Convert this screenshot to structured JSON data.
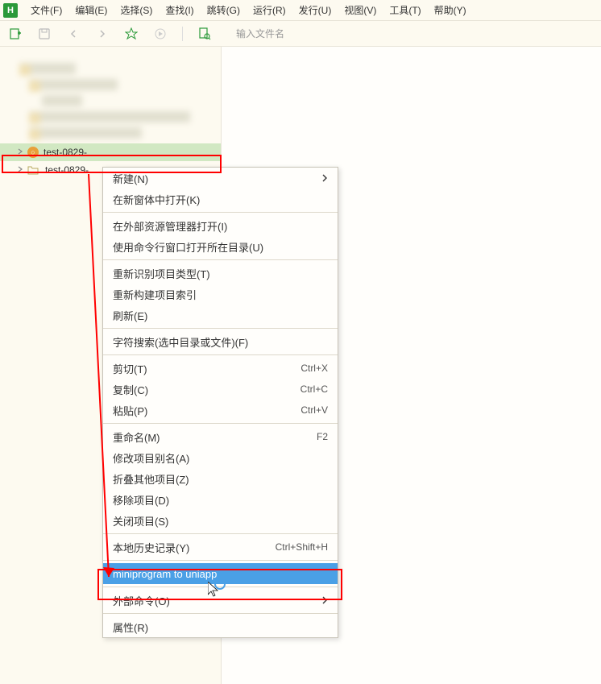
{
  "menubar": {
    "logo": "H",
    "items": [
      "文件(F)",
      "编辑(E)",
      "选择(S)",
      "查找(I)",
      "跳转(G)",
      "运行(R)",
      "发行(U)",
      "视图(V)",
      "工具(T)",
      "帮助(Y)"
    ]
  },
  "toolbar": {
    "search_placeholder": "输入文件名"
  },
  "sidebar": {
    "items": [
      {
        "label": "test-0829-",
        "selected": true
      },
      {
        "label": "test-0829-",
        "selected": false
      }
    ]
  },
  "context_menu": {
    "groups": [
      [
        {
          "label": "新建(N)",
          "submenu": true
        },
        {
          "label": "在新窗体中打开(K)"
        }
      ],
      [
        {
          "label": "在外部资源管理器打开(I)"
        },
        {
          "label": "使用命令行窗口打开所在目录(U)"
        }
      ],
      [
        {
          "label": "重新识别项目类型(T)"
        },
        {
          "label": "重新构建项目索引"
        },
        {
          "label": "刷新(E)"
        }
      ],
      [
        {
          "label": "字符搜索(选中目录或文件)(F)"
        }
      ],
      [
        {
          "label": "剪切(T)",
          "shortcut": "Ctrl+X"
        },
        {
          "label": "复制(C)",
          "shortcut": "Ctrl+C"
        },
        {
          "label": "粘贴(P)",
          "shortcut": "Ctrl+V"
        }
      ],
      [
        {
          "label": "重命名(M)",
          "shortcut": "F2"
        },
        {
          "label": "修改项目别名(A)"
        },
        {
          "label": "折叠其他项目(Z)"
        },
        {
          "label": "移除项目(D)"
        },
        {
          "label": "关闭项目(S)"
        }
      ],
      [
        {
          "label": "本地历史记录(Y)",
          "shortcut": "Ctrl+Shift+H"
        }
      ],
      [
        {
          "label": "miniprogram to uniapp",
          "highlighted": true
        }
      ],
      [
        {
          "label": "外部命令(O)",
          "submenu": true
        }
      ],
      [
        {
          "label": "属性(R)"
        }
      ]
    ]
  }
}
